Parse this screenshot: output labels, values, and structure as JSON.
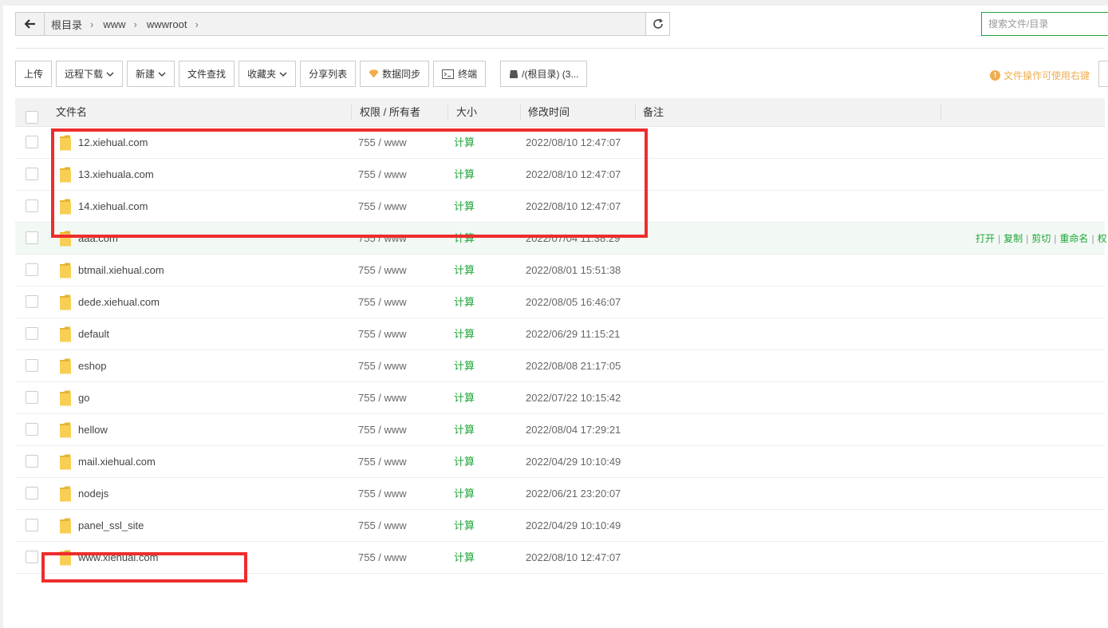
{
  "nav": {
    "breadcrumbs": [
      "根目录",
      "www",
      "wwwroot"
    ],
    "search_placeholder": "搜索文件/目录"
  },
  "toolbar": {
    "upload": "上传",
    "remote_download": "远程下载",
    "new": "新建",
    "file_search": "文件查找",
    "favorites": "收藏夹",
    "share_list": "分享列表",
    "data_sync": "数据同步",
    "terminal": "终端",
    "disk": "/(根目录) (3...",
    "hint": "文件操作可使用右键"
  },
  "table": {
    "headers": {
      "name": "文件名",
      "perm": "权限 / 所有者",
      "size": "大小",
      "mtime": "修改时间",
      "note": "备注"
    },
    "rows": [
      {
        "name": "12.xiehual.com",
        "perm": "755 / www",
        "size": "计算",
        "mtime": "2022/08/10 12:47:07"
      },
      {
        "name": "13.xiehuala.com",
        "perm": "755 / www",
        "size": "计算",
        "mtime": "2022/08/10 12:47:07"
      },
      {
        "name": "14.xiehual.com",
        "perm": "755 / www",
        "size": "计算",
        "mtime": "2022/08/10 12:47:07"
      },
      {
        "name": "aaa.com",
        "perm": "755 / www",
        "size": "计算",
        "mtime": "2022/07/04 11:38:29"
      },
      {
        "name": "btmail.xiehual.com",
        "perm": "755 / www",
        "size": "计算",
        "mtime": "2022/08/01 15:51:38"
      },
      {
        "name": "dede.xiehual.com",
        "perm": "755 / www",
        "size": "计算",
        "mtime": "2022/08/05 16:46:07"
      },
      {
        "name": "default",
        "perm": "755 / www",
        "size": "计算",
        "mtime": "2022/06/29 11:15:21"
      },
      {
        "name": "eshop",
        "perm": "755 / www",
        "size": "计算",
        "mtime": "2022/08/08 21:17:05"
      },
      {
        "name": "go",
        "perm": "755 / www",
        "size": "计算",
        "mtime": "2022/07/22 10:15:42"
      },
      {
        "name": "hellow",
        "perm": "755 / www",
        "size": "计算",
        "mtime": "2022/08/04 17:29:21"
      },
      {
        "name": "mail.xiehual.com",
        "perm": "755 / www",
        "size": "计算",
        "mtime": "2022/04/29 10:10:49"
      },
      {
        "name": "nodejs",
        "perm": "755 / www",
        "size": "计算",
        "mtime": "2022/06/21 23:20:07"
      },
      {
        "name": "panel_ssl_site",
        "perm": "755 / www",
        "size": "计算",
        "mtime": "2022/04/29 10:10:49"
      },
      {
        "name": "www.xiehual.com",
        "perm": "755 / www",
        "size": "计算",
        "mtime": "2022/08/10 12:47:07"
      }
    ],
    "hovered_row_ops": [
      "打开",
      "复制",
      "剪切",
      "重命名",
      "权"
    ]
  },
  "colors": {
    "accent": "#20a53a",
    "annotation": "#ee2d2d",
    "folder": "#f5c842",
    "hint": "#f0ad4e"
  }
}
